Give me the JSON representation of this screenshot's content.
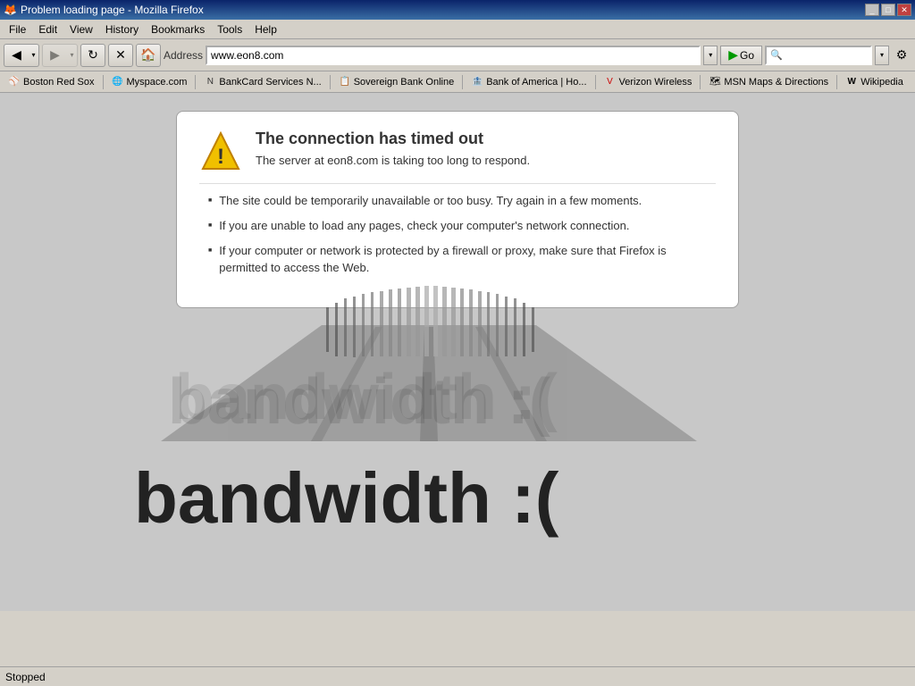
{
  "window": {
    "title": "Problem loading page - Mozilla Firefox",
    "favicon": "🦊"
  },
  "menubar": {
    "items": [
      "File",
      "Edit",
      "View",
      "History",
      "Bookmarks",
      "Tools",
      "Help"
    ]
  },
  "navbar": {
    "address": "www.eon8.com",
    "go_label": "Go",
    "search_placeholder": ""
  },
  "bookmarks": {
    "items": [
      {
        "label": "Boston Red Sox",
        "icon": "⚾"
      },
      {
        "label": "Myspace.com",
        "icon": "🌐"
      },
      {
        "label": "BankCard Services N...",
        "icon": "🏦"
      },
      {
        "label": "Sovereign Bank Online",
        "icon": "🏦"
      },
      {
        "label": "Bank of America | Ho...",
        "icon": "🏦"
      },
      {
        "label": "Verizon Wireless",
        "icon": "📱"
      },
      {
        "label": "MSN Maps & Directions",
        "icon": "🗺"
      },
      {
        "label": "Wikipedia",
        "icon": "W"
      }
    ]
  },
  "error": {
    "title": "The connection has timed out",
    "subtitle": "The server at eon8.com is taking too long to respond.",
    "bullets": [
      "The site could be temporarily unavailable or too busy. Try again in a few moments.",
      "If you are unable to load any pages, check your computer's network connection.",
      "If your computer or network is protected by a firewall or proxy, make sure that Firefox is permitted to access the Web."
    ]
  },
  "bandwidth": {
    "text": "bandwidth :("
  },
  "statusbar": {
    "text": "Stopped"
  }
}
